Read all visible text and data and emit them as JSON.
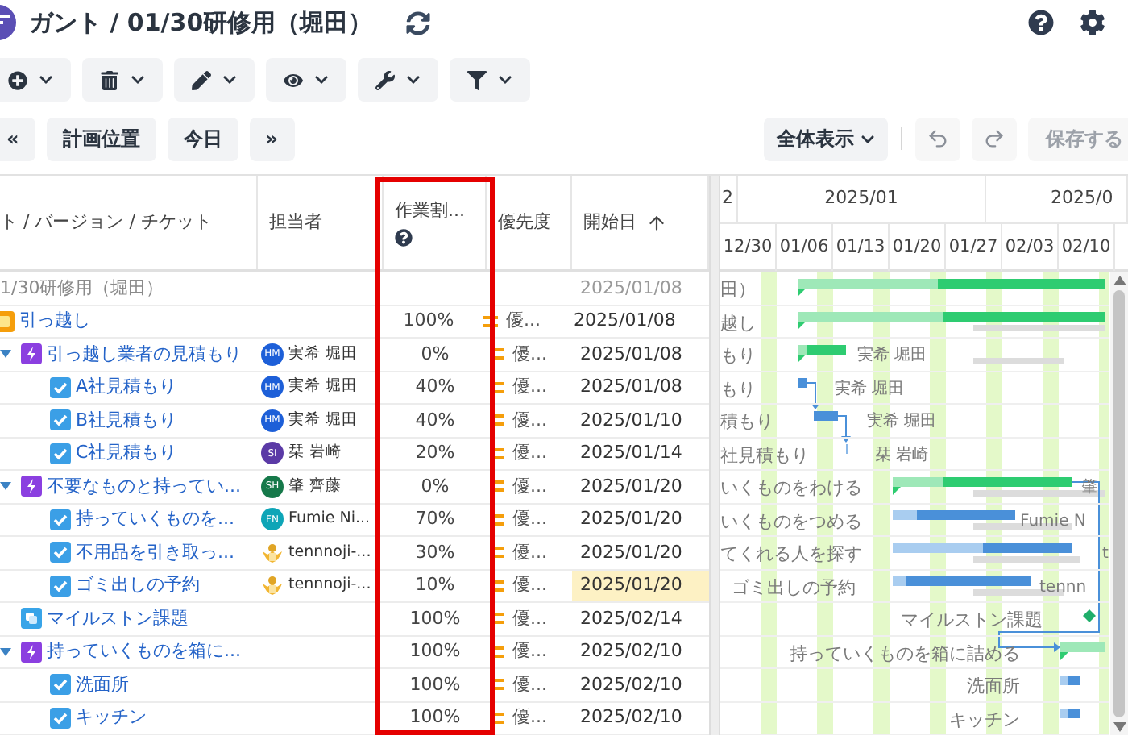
{
  "header": {
    "title": "ガント / 01/30研修用（堀田）"
  },
  "navigation": {
    "buttons": [
      "«",
      "計画位置",
      "今日",
      "»"
    ]
  },
  "view_button": {
    "label": "全体表示"
  },
  "undo": {
    "disabled": true
  },
  "redo": {
    "disabled": true
  },
  "save": {
    "label": "保存する",
    "disabled": true
  },
  "table": {
    "columns": [
      {
        "label": "ト / バージョン / チケット",
        "help": false,
        "sorted": false
      },
      {
        "label": "担当者",
        "help": false,
        "sorted": false
      },
      {
        "label": "作業割...",
        "help": true,
        "sorted": false
      },
      {
        "label": "優先度",
        "help": false,
        "sorted": false
      },
      {
        "label": "開始日",
        "help": false,
        "sorted": true
      }
    ],
    "rows": [
      {
        "kind": "version",
        "name": "1/30研修用（堀田）",
        "start": "2025/01/08",
        "start_selected": false,
        "children": [
          {
            "kind": "project",
            "name": "引っ越し",
            "progress": "100%",
            "priority": "優...",
            "start": "2025/01/08",
            "start_selected": false,
            "children": [
              {
                "kind": "feature",
                "name": "引っ越し業者の見積もり",
                "expanded": true,
                "assignee": {
                  "kind": "initials",
                  "initials": "HM",
                  "color": "#1d5fd8",
                  "name": "実希 堀田"
                },
                "progress": "0%",
                "priority": "優...",
                "start": "2025/01/08",
                "start_selected": false,
                "children": [
                  {
                    "kind": "task",
                    "name": "A社見積もり",
                    "assignee": {
                      "kind": "initials",
                      "initials": "HM",
                      "color": "#1d5fd8",
                      "name": "実希 堀田"
                    },
                    "progress": "40%",
                    "priority": "優...",
                    "start": "2025/01/08",
                    "start_selected": false
                  },
                  {
                    "kind": "task",
                    "name": "B社見積もり",
                    "assignee": {
                      "kind": "initials",
                      "initials": "HM",
                      "color": "#1d5fd8",
                      "name": "実希 堀田"
                    },
                    "progress": "40%",
                    "priority": "優...",
                    "start": "2025/01/10",
                    "start_selected": false
                  },
                  {
                    "kind": "task",
                    "name": "C社見積もり",
                    "assignee": {
                      "kind": "initials",
                      "initials": "SI",
                      "color": "#5b3aa6",
                      "name": "栞 岩崎"
                    },
                    "progress": "20%",
                    "priority": "優...",
                    "start": "2025/01/14",
                    "start_selected": false
                  }
                ]
              },
              {
                "kind": "feature",
                "name": "不要なものと持ってい...",
                "expanded": true,
                "assignee": {
                  "kind": "initials",
                  "initials": "SH",
                  "color": "#16794a",
                  "name": "肇 齊藤"
                },
                "progress": "0%",
                "priority": "優...",
                "start": "2025/01/20",
                "start_selected": false,
                "children": [
                  {
                    "kind": "task",
                    "name": "持っていくものを...",
                    "assignee": {
                      "kind": "initials",
                      "initials": "FN",
                      "color": "#0ea5b7",
                      "name": "Fumie Ni..."
                    },
                    "progress": "70%",
                    "priority": "優...",
                    "start": "2025/01/20",
                    "start_selected": false
                  },
                  {
                    "kind": "task",
                    "name": "不用品を引き取っ...",
                    "assignee": {
                      "kind": "emblem",
                      "name": "tennnoji-..."
                    },
                    "progress": "30%",
                    "priority": "優...",
                    "start": "2025/01/20",
                    "start_selected": false
                  },
                  {
                    "kind": "task",
                    "name": "ゴミ出しの予約",
                    "assignee": {
                      "kind": "emblem",
                      "name": "tennnoji-..."
                    },
                    "progress": "10%",
                    "priority": "優...",
                    "start": "2025/01/20",
                    "start_selected": true
                  }
                ]
              },
              {
                "kind": "milestone",
                "name": "マイルストン課題",
                "progress": "100%",
                "priority": "優...",
                "start": "2025/02/14",
                "start_selected": false
              },
              {
                "kind": "feature",
                "name": "持っていくものを箱に...",
                "expanded": true,
                "progress": "100%",
                "priority": "優...",
                "start": "2025/02/10",
                "start_selected": false,
                "children": [
                  {
                    "kind": "task",
                    "name": "洗面所",
                    "progress": "100%",
                    "priority": "優...",
                    "start": "2025/02/10",
                    "start_selected": false
                  },
                  {
                    "kind": "task",
                    "name": "キッチン",
                    "progress": "100%",
                    "priority": "優...",
                    "start": "2025/02/10",
                    "start_selected": false
                  }
                ]
              }
            ]
          }
        ]
      }
    ]
  },
  "gantt": {
    "months": [
      "2",
      "2025/01",
      "2025/0"
    ],
    "weeks": [
      "12/30",
      "01/06",
      "01/13",
      "01/20",
      "01/27",
      "02/03",
      "02/10"
    ],
    "rows": [
      {
        "label": "田）"
      },
      {
        "label": "越し"
      },
      {
        "label": "もり",
        "assignee": "実希 堀田"
      },
      {
        "label": "もり",
        "assignee": "実希 堀田"
      },
      {
        "label": "積もり",
        "assignee": "実希 堀田"
      },
      {
        "label": "社見積もり",
        "assignee": "栞 岩崎"
      },
      {
        "label": "いくものをわける",
        "assignee": "肇"
      },
      {
        "label": "いくものをつめる",
        "assignee": "Fumie N"
      },
      {
        "label": "てくれる人を探す",
        "assignee": "t"
      },
      {
        "label": "ゴミ出しの予約",
        "assignee": "tennn"
      },
      {
        "label": "マイルストン課題"
      },
      {
        "label": "持っていくものを箱に詰める"
      },
      {
        "label": "洗面所"
      },
      {
        "label": "キッチン"
      }
    ]
  }
}
